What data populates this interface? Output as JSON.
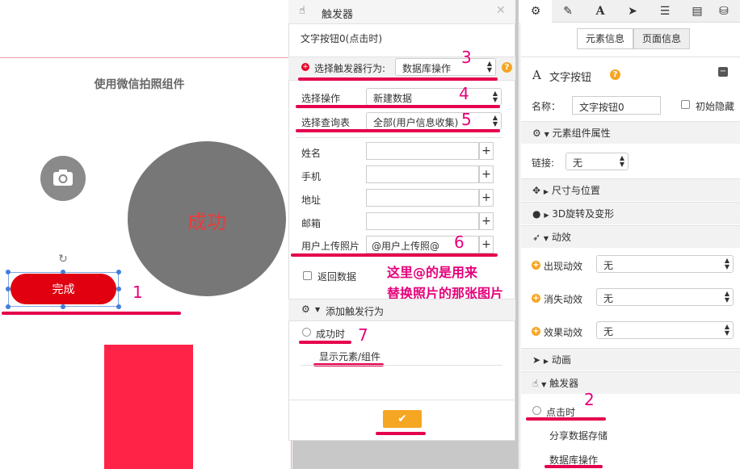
{
  "canvas": {
    "title": "使用微信拍照组件",
    "circle_text": "成功",
    "done_button": "完成"
  },
  "annotations": {
    "n1": "1",
    "n2": "2",
    "n3": "3",
    "n4": "4",
    "n5": "5",
    "n6": "6",
    "n7": "7",
    "note_line1": "这里@的是用来",
    "note_line2": "替换照片的那张图片"
  },
  "dialog": {
    "title": "触发器",
    "subtitle": "文字按钮0(点击时)",
    "behavior_label": "选择触发器行为:",
    "behavior_value": "数据库操作",
    "op_label": "选择操作",
    "op_value": "新建数据",
    "table_label": "选择查询表",
    "table_value": "全部(用户信息收集)",
    "fields": [
      {
        "label": "姓名",
        "value": ""
      },
      {
        "label": "手机",
        "value": ""
      },
      {
        "label": "地址",
        "value": ""
      },
      {
        "label": "邮箱",
        "value": ""
      },
      {
        "label": "用户上传照片",
        "value": "@用户上传照@"
      }
    ],
    "return_data": "返回数据",
    "add_behavior": "添加触发行为",
    "success_label": "成功时",
    "success_action": "显示元素/组件",
    "confirm": "✔"
  },
  "panel": {
    "tabs": [
      "gear-icon",
      "pencil-icon",
      "text-icon",
      "send-icon",
      "list-icon",
      "doc-icon",
      "database-icon"
    ],
    "subtab_element": "元素信息",
    "subtab_page": "页面信息",
    "component_title": "文字按钮",
    "name_label": "名称：",
    "name_value": "文字按钮0",
    "hide_label": "初始隐藏",
    "attrs_section": "元素组件属性",
    "link_label": "链接:",
    "link_value": "无",
    "size_section": "尺寸与位置",
    "rotate_section": "3D旋转及变形",
    "anim_section": "动效",
    "anim_rows": [
      {
        "label": "出现动效",
        "value": "无"
      },
      {
        "label": "消失动效",
        "value": "无"
      },
      {
        "label": "效果动效",
        "value": "无"
      }
    ],
    "animation_section": "动画",
    "trigger_section": "触发器",
    "trigger_click": "点击时",
    "trigger_share": "分享数据存储",
    "trigger_db": "数据库操作"
  },
  "colors": {
    "accent_red": "#e00010",
    "annotation_pink": "#e5007a",
    "orange": "#f5a623"
  }
}
